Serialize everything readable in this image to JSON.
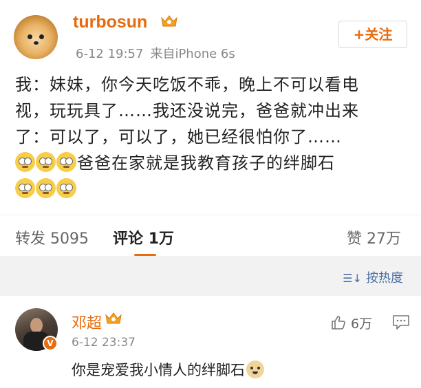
{
  "post": {
    "username": "turbosun",
    "date": "6-12 19:57",
    "source": "来自iPhone 6s",
    "follow_label": "+关注",
    "line1": "我：妹妹，你今天吃饭不乖，晚上不可以看电",
    "line2": "视，玩玩具了……我还没说完，爸爸就冲出来",
    "line3": "了：可以了，可以了，她已经很怕你了……",
    "line4_text": "爸爸在家就是我教育孩子的绊脚石"
  },
  "stats": {
    "repost_label": "转发",
    "repost_count": "5095",
    "comment_label": "评论",
    "comment_count": "1万",
    "like_label": "赞",
    "like_count": "27万"
  },
  "sort": {
    "label": "按热度"
  },
  "comment": {
    "name": "邓超",
    "date": "6-12 23:37",
    "text": "你是宠爱我小情人的绊脚石",
    "like_count": "6万"
  },
  "colors": {
    "accent": "#e86b0c",
    "link": "#4a6fa5"
  }
}
